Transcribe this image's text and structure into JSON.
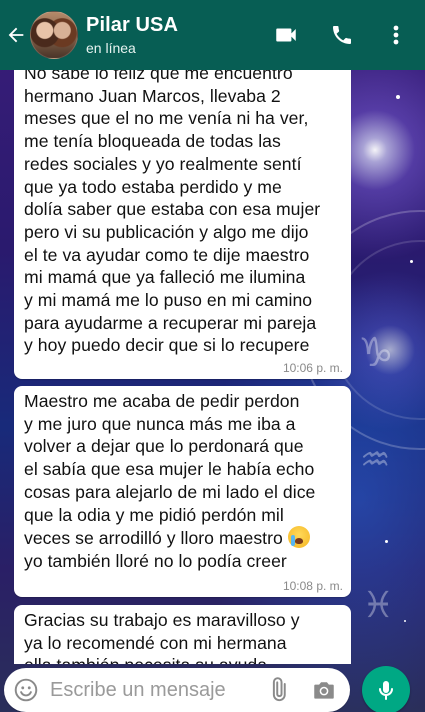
{
  "header": {
    "contact_name": "Pilar USA",
    "status": "en línea",
    "color": "#075e54",
    "icons": [
      "back-arrow-icon",
      "video-call-icon",
      "phone-icon",
      "more-options-icon"
    ]
  },
  "messages": [
    {
      "text": "No sabe lo feliz que me encuentro\nhermano Juan Marcos, llevaba 2\nmeses que el no me venía ni ha ver,\nme tenía bloqueada de todas las\nredes sociales y yo realmente sentí\nque ya todo estaba perdido y me\ndolía saber que estaba con esa mujer\npero vi su publicación y algo me dijo\nel te va ayudar como te dije maestro\nmi mamá que ya falleció me ilumina\ny mi mamá me lo puso en mi camino\npara ayudarme a recuperar mi pareja\ny hoy puedo decir que si lo recupere",
      "time": "10:06 p. m."
    },
    {
      "text": "Maestro me acaba de pedir perdon\ny me juro que nunca más me iba a\nvolver a dejar que lo perdonará que\nel sabía que esa mujer le había echo\ncosas para alejarlo de mi lado el dice\nque la odia y me pidió perdón mil\nveces se arrodilló y lloro maestro ",
      "text_tail": "yo también lloré no lo podía creer",
      "emoji": "crying-face-emoji",
      "time": "10:08 p. m."
    },
    {
      "text": "Gracias su trabajo es maravilloso y\nya lo recomendé con mi hermana\nella también necesita su ayuda"
    }
  ],
  "composer": {
    "placeholder": "Escribe un mensaje",
    "mic_color": "#00a884",
    "icons": [
      "emoji-icon",
      "attach-icon",
      "camera-icon",
      "mic-icon"
    ]
  }
}
